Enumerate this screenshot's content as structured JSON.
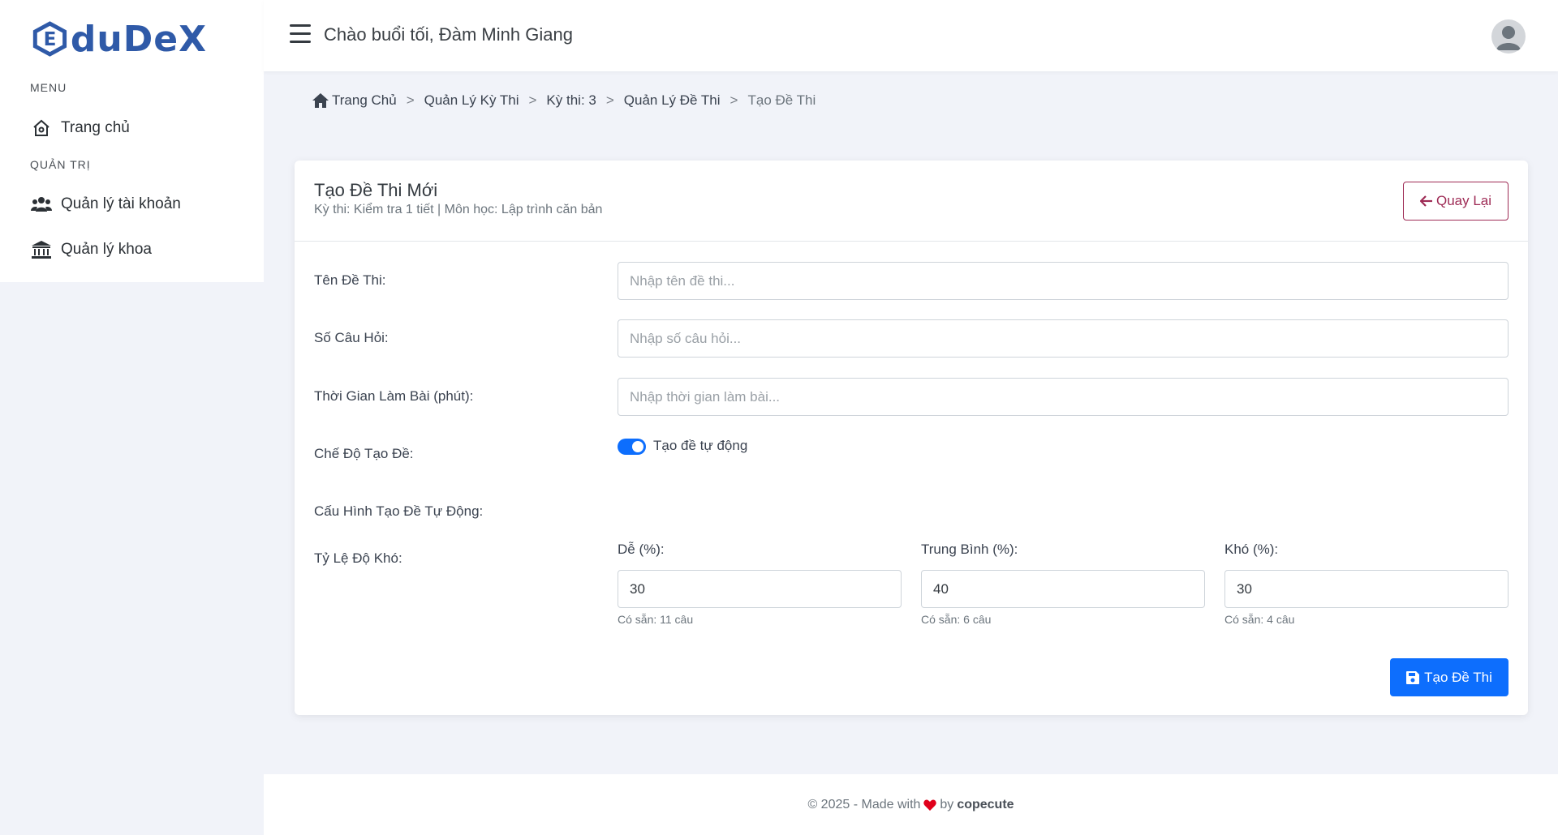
{
  "app": {
    "logo_text": "duDeX",
    "logo_letter": "E",
    "brand_color": "#2f5aa8"
  },
  "sidebar": {
    "menu_heading": "MENU",
    "admin_heading": "QUẢN TRỊ",
    "items": [
      {
        "label": "Trang chủ",
        "icon": "home-icon"
      },
      {
        "label": "Quản lý tài khoản",
        "icon": "users-icon"
      },
      {
        "label": "Quản lý khoa",
        "icon": "institution-icon"
      }
    ]
  },
  "header": {
    "greeting": "Chào buổi tối, Đàm Minh Giang",
    "menu_icon": "hamburger-icon",
    "avatar_icon": "user-avatar-icon"
  },
  "breadcrumb": {
    "items": [
      "Trang Chủ",
      "Quản Lý Kỳ Thi",
      "Kỳ thi: 3",
      "Quản Lý Đề Thi"
    ],
    "current": "Tạo Đề Thi",
    "separator": ">"
  },
  "card": {
    "title": "Tạo Đề Thi Mới",
    "subtitle": "Kỳ thi: Kiểm tra 1 tiết | Môn học: Lập trình căn bản",
    "back_label": "Quay Lại"
  },
  "form": {
    "name_label": "Tên Đề Thi:",
    "name_placeholder": "Nhập tên đề thi...",
    "count_label": "Số Câu Hỏi:",
    "count_placeholder": "Nhập số câu hỏi...",
    "time_label": "Thời Gian Làm Bài (phút):",
    "time_placeholder": "Nhập thời gian làm bài...",
    "mode_label": "Chế Độ Tạo Đề:",
    "mode_toggle_label": "Tạo đề tự động",
    "mode_toggle_on": true,
    "auto_config_label": "Cấu Hình Tạo Đề Tự Động:",
    "difficulty_label": "Tỷ Lệ Độ Khó:",
    "levels": [
      {
        "label": "Dễ (%):",
        "value": "30",
        "available": "Có sẵn: 11 câu"
      },
      {
        "label": "Trung Bình (%):",
        "value": "40",
        "available": "Có sẵn: 6 câu"
      },
      {
        "label": "Khó (%):",
        "value": "30",
        "available": "Có sẵn: 4 câu"
      }
    ],
    "submit_label": "Tạo Đề Thi"
  },
  "footer": {
    "prefix": "© 2025 - Made with",
    "by": "by",
    "author": "copecute"
  },
  "colors": {
    "primary": "#0d6efd",
    "back_button": "#9e2b55",
    "heart": "#e0001b"
  }
}
